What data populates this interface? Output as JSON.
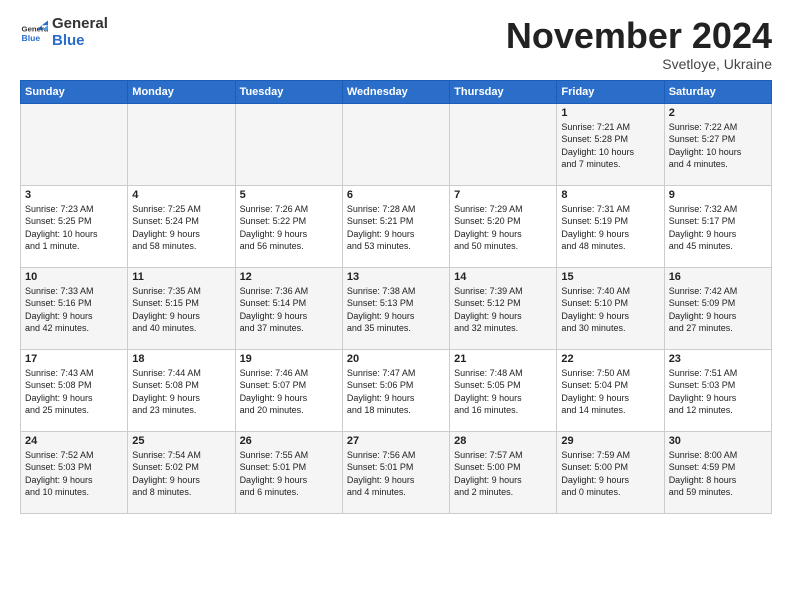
{
  "logo": {
    "general": "General",
    "blue": "Blue"
  },
  "header": {
    "month": "November 2024",
    "location": "Svetloye, Ukraine"
  },
  "weekdays": [
    "Sunday",
    "Monday",
    "Tuesday",
    "Wednesday",
    "Thursday",
    "Friday",
    "Saturday"
  ],
  "weeks": [
    [
      {
        "day": "",
        "info": ""
      },
      {
        "day": "",
        "info": ""
      },
      {
        "day": "",
        "info": ""
      },
      {
        "day": "",
        "info": ""
      },
      {
        "day": "",
        "info": ""
      },
      {
        "day": "1",
        "info": "Sunrise: 7:21 AM\nSunset: 5:28 PM\nDaylight: 10 hours\nand 7 minutes."
      },
      {
        "day": "2",
        "info": "Sunrise: 7:22 AM\nSunset: 5:27 PM\nDaylight: 10 hours\nand 4 minutes."
      }
    ],
    [
      {
        "day": "3",
        "info": "Sunrise: 7:23 AM\nSunset: 5:25 PM\nDaylight: 10 hours\nand 1 minute."
      },
      {
        "day": "4",
        "info": "Sunrise: 7:25 AM\nSunset: 5:24 PM\nDaylight: 9 hours\nand 58 minutes."
      },
      {
        "day": "5",
        "info": "Sunrise: 7:26 AM\nSunset: 5:22 PM\nDaylight: 9 hours\nand 56 minutes."
      },
      {
        "day": "6",
        "info": "Sunrise: 7:28 AM\nSunset: 5:21 PM\nDaylight: 9 hours\nand 53 minutes."
      },
      {
        "day": "7",
        "info": "Sunrise: 7:29 AM\nSunset: 5:20 PM\nDaylight: 9 hours\nand 50 minutes."
      },
      {
        "day": "8",
        "info": "Sunrise: 7:31 AM\nSunset: 5:19 PM\nDaylight: 9 hours\nand 48 minutes."
      },
      {
        "day": "9",
        "info": "Sunrise: 7:32 AM\nSunset: 5:17 PM\nDaylight: 9 hours\nand 45 minutes."
      }
    ],
    [
      {
        "day": "10",
        "info": "Sunrise: 7:33 AM\nSunset: 5:16 PM\nDaylight: 9 hours\nand 42 minutes."
      },
      {
        "day": "11",
        "info": "Sunrise: 7:35 AM\nSunset: 5:15 PM\nDaylight: 9 hours\nand 40 minutes."
      },
      {
        "day": "12",
        "info": "Sunrise: 7:36 AM\nSunset: 5:14 PM\nDaylight: 9 hours\nand 37 minutes."
      },
      {
        "day": "13",
        "info": "Sunrise: 7:38 AM\nSunset: 5:13 PM\nDaylight: 9 hours\nand 35 minutes."
      },
      {
        "day": "14",
        "info": "Sunrise: 7:39 AM\nSunset: 5:12 PM\nDaylight: 9 hours\nand 32 minutes."
      },
      {
        "day": "15",
        "info": "Sunrise: 7:40 AM\nSunset: 5:10 PM\nDaylight: 9 hours\nand 30 minutes."
      },
      {
        "day": "16",
        "info": "Sunrise: 7:42 AM\nSunset: 5:09 PM\nDaylight: 9 hours\nand 27 minutes."
      }
    ],
    [
      {
        "day": "17",
        "info": "Sunrise: 7:43 AM\nSunset: 5:08 PM\nDaylight: 9 hours\nand 25 minutes."
      },
      {
        "day": "18",
        "info": "Sunrise: 7:44 AM\nSunset: 5:08 PM\nDaylight: 9 hours\nand 23 minutes."
      },
      {
        "day": "19",
        "info": "Sunrise: 7:46 AM\nSunset: 5:07 PM\nDaylight: 9 hours\nand 20 minutes."
      },
      {
        "day": "20",
        "info": "Sunrise: 7:47 AM\nSunset: 5:06 PM\nDaylight: 9 hours\nand 18 minutes."
      },
      {
        "day": "21",
        "info": "Sunrise: 7:48 AM\nSunset: 5:05 PM\nDaylight: 9 hours\nand 16 minutes."
      },
      {
        "day": "22",
        "info": "Sunrise: 7:50 AM\nSunset: 5:04 PM\nDaylight: 9 hours\nand 14 minutes."
      },
      {
        "day": "23",
        "info": "Sunrise: 7:51 AM\nSunset: 5:03 PM\nDaylight: 9 hours\nand 12 minutes."
      }
    ],
    [
      {
        "day": "24",
        "info": "Sunrise: 7:52 AM\nSunset: 5:03 PM\nDaylight: 9 hours\nand 10 minutes."
      },
      {
        "day": "25",
        "info": "Sunrise: 7:54 AM\nSunset: 5:02 PM\nDaylight: 9 hours\nand 8 minutes."
      },
      {
        "day": "26",
        "info": "Sunrise: 7:55 AM\nSunset: 5:01 PM\nDaylight: 9 hours\nand 6 minutes."
      },
      {
        "day": "27",
        "info": "Sunrise: 7:56 AM\nSunset: 5:01 PM\nDaylight: 9 hours\nand 4 minutes."
      },
      {
        "day": "28",
        "info": "Sunrise: 7:57 AM\nSunset: 5:00 PM\nDaylight: 9 hours\nand 2 minutes."
      },
      {
        "day": "29",
        "info": "Sunrise: 7:59 AM\nSunset: 5:00 PM\nDaylight: 9 hours\nand 0 minutes."
      },
      {
        "day": "30",
        "info": "Sunrise: 8:00 AM\nSunset: 4:59 PM\nDaylight: 8 hours\nand 59 minutes."
      }
    ]
  ]
}
